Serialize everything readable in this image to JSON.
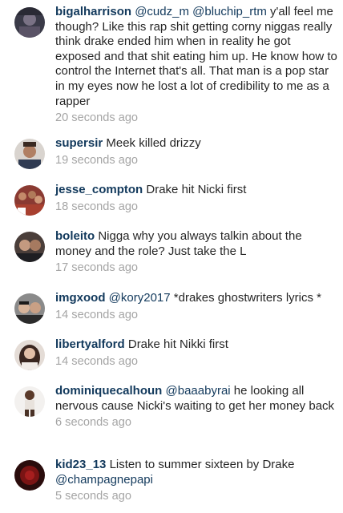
{
  "comments": [
    {
      "username": "bigalharrison",
      "parts": [
        {
          "type": "mention",
          "text": "@cudz_m"
        },
        {
          "type": "text",
          "text": " "
        },
        {
          "type": "mention",
          "text": "@bluchip_rtm"
        },
        {
          "type": "text",
          "text": " y'all feel me though? Like this rap shit getting corny niggas really think drake ended him when in reality he got exposed and that shit eating him up. He know how to control the Internet that's all. That man is a pop star in my eyes now he lost a lot of credibility to me as a rapper"
        }
      ],
      "time": "20 seconds ago"
    },
    {
      "username": "supersir",
      "parts": [
        {
          "type": "text",
          "text": "Meek killed drizzy"
        }
      ],
      "time": "19 seconds ago"
    },
    {
      "username": "jesse_compton",
      "parts": [
        {
          "type": "text",
          "text": "Drake hit Nicki first"
        }
      ],
      "time": "18 seconds ago"
    },
    {
      "username": "boleito",
      "parts": [
        {
          "type": "text",
          "text": "Nigga why you always talkin about the money and the role? Just take the L"
        }
      ],
      "time": "17 seconds ago"
    },
    {
      "username": "imgxood",
      "parts": [
        {
          "type": "mention",
          "text": "@kory2017"
        },
        {
          "type": "text",
          "text": " *drakes ghostwriters lyrics *"
        }
      ],
      "time": "14 seconds ago"
    },
    {
      "username": "libertyalford",
      "parts": [
        {
          "type": "text",
          "text": "Drake hit Nikki first"
        }
      ],
      "time": "14 seconds ago"
    },
    {
      "username": "dominiquecalhoun",
      "parts": [
        {
          "type": "mention",
          "text": "@baaabyrai"
        },
        {
          "type": "text",
          "text": " he looking all nervous cause Nicki's waiting to get her money back"
        }
      ],
      "time": "6 seconds ago"
    },
    {
      "username": "kid23_13",
      "parts": [
        {
          "type": "text",
          "text": "Listen to summer sixteen by Drake "
        },
        {
          "type": "mention",
          "text": "@champagnepapi"
        }
      ],
      "time": "5 seconds ago"
    }
  ]
}
